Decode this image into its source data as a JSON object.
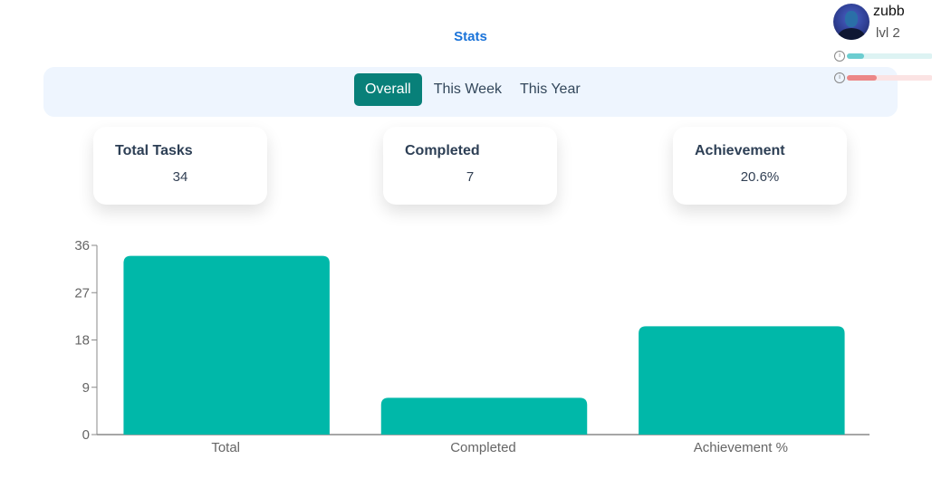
{
  "header": {
    "title": "Stats"
  },
  "tabs": [
    {
      "label": "Overall",
      "active": true
    },
    {
      "label": "This Week",
      "active": false
    },
    {
      "label": "This Year",
      "active": false
    }
  ],
  "cards": [
    {
      "label": "Total Tasks",
      "value": "34"
    },
    {
      "label": "Completed",
      "value": "7"
    },
    {
      "label": "Achievement",
      "value": "20.6%"
    }
  ],
  "profile": {
    "username": "zubb",
    "level": "lvl 2",
    "bars": [
      {
        "icon": "info-icon",
        "progress": 0.2,
        "color": "#6ccdd0",
        "track": "#ddf3f3"
      },
      {
        "icon": "info-icon",
        "progress": 0.35,
        "color": "#ec8787",
        "track": "#fbe3e3"
      }
    ]
  },
  "colors": {
    "accent": "#088079",
    "bar": "#00b8a9",
    "title": "#1a73d9"
  },
  "chart_data": {
    "type": "bar",
    "categories": [
      "Total",
      "Completed",
      "Achievement %"
    ],
    "values": [
      34,
      7,
      20.6
    ],
    "yticks": [
      0,
      9,
      18,
      27,
      36
    ],
    "ylim": [
      0,
      36
    ],
    "grid": false,
    "title": "",
    "xlabel": "",
    "ylabel": ""
  }
}
